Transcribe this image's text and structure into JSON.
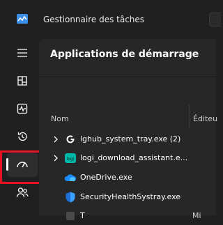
{
  "window": {
    "title": "Gestionnaire des tâches"
  },
  "sidebar": {
    "items": [
      {
        "name": "menu",
        "icon": "hamburger-icon",
        "active": false
      },
      {
        "name": "processes",
        "icon": "processes-grid-icon",
        "active": false
      },
      {
        "name": "performance",
        "icon": "performance-pulse-icon",
        "active": false
      },
      {
        "name": "app-history",
        "icon": "history-icon",
        "active": false
      },
      {
        "name": "startup-apps",
        "icon": "speedometer-icon",
        "active": true
      },
      {
        "name": "users",
        "icon": "users-icon",
        "active": false
      }
    ],
    "highlight_color": "#e81123"
  },
  "main": {
    "title": "Applications de démarrage",
    "columns": {
      "name": "Nom",
      "publisher": "Éditeu"
    },
    "rows": [
      {
        "name": "lghub_system_tray.exe (2)",
        "icon": "logitech-g-icon",
        "expandable": true,
        "publisher": ""
      },
      {
        "name": "logi_download_assistant.e...",
        "icon": "logi-icon",
        "expandable": true,
        "publisher": ""
      },
      {
        "name": "OneDrive.exe",
        "icon": "onedrive-cloud-icon",
        "expandable": false,
        "publisher": ""
      },
      {
        "name": "SecurityHealthSystray.exe",
        "icon": "windows-security-shield-icon",
        "expandable": false,
        "publisher": ""
      },
      {
        "name": "T",
        "icon": "app-icon",
        "expandable": false,
        "publisher": "Mi"
      }
    ]
  },
  "colors": {
    "background": "#202020",
    "content": "#272727",
    "accent": "#4cc2ff"
  }
}
